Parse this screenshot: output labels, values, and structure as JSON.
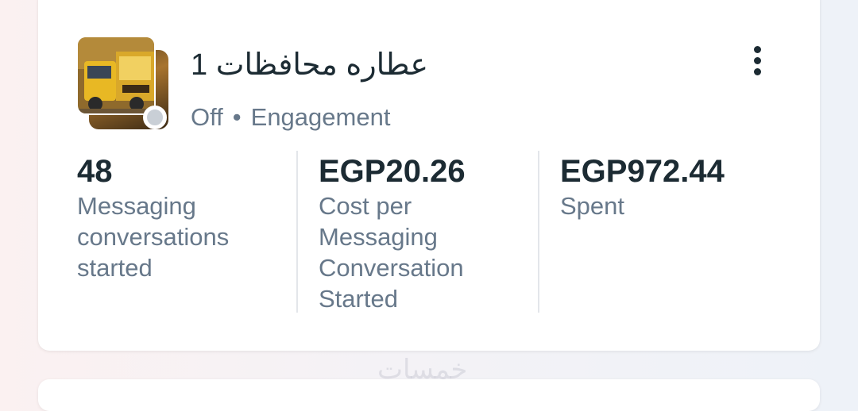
{
  "campaign": {
    "title": "عطاره محافظات 1",
    "status": "Off",
    "separator": "•",
    "objective": "Engagement",
    "status_color": "#c9cfd6",
    "thumbnail_icon": "truck-ad-thumbnail"
  },
  "menu": {
    "icon": "more-vertical-icon"
  },
  "metrics": [
    {
      "value": "48",
      "label": "Messaging conversations started"
    },
    {
      "value": "EGP20.26",
      "label": "Cost per Messaging Conversation Started"
    },
    {
      "value": "EGP972.44",
      "label": "Spent"
    }
  ],
  "watermark": "خمسات"
}
